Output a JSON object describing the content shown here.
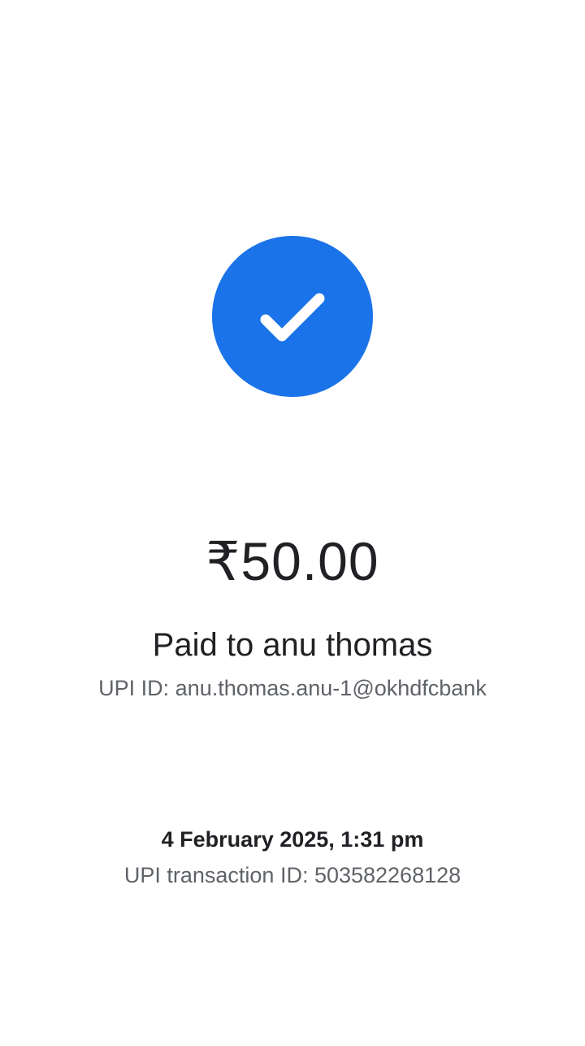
{
  "status": {
    "icon": "check-icon",
    "accent_color": "#1a73e8"
  },
  "payment": {
    "amount": "₹50.00",
    "paid_to": "Paid to anu thomas",
    "upi_id": "UPI ID: anu.thomas.anu-1@okhdfcbank"
  },
  "transaction": {
    "datetime": "4 February 2025, 1:31 pm",
    "txn_id": "UPI transaction ID: 503582268128"
  }
}
